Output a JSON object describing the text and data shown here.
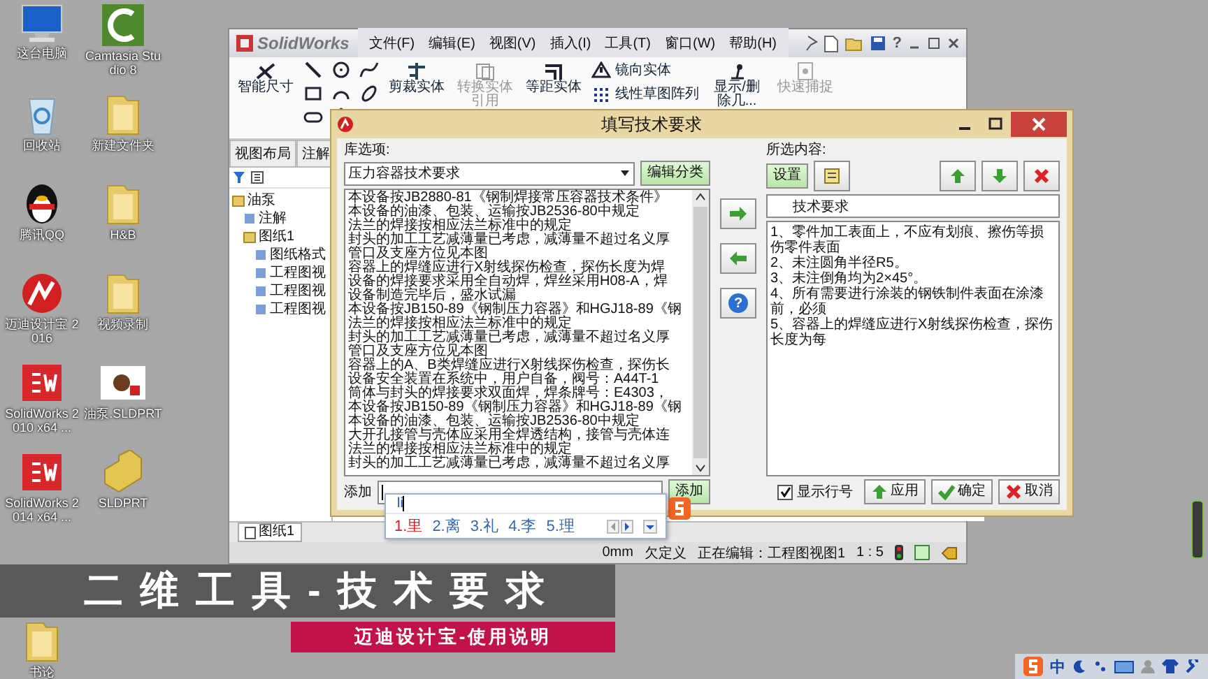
{
  "desktop": {
    "icons": [
      {
        "kind": "computer",
        "label": "这台电脑"
      },
      {
        "kind": "camtasia",
        "label": "Camtasia Studio 8"
      },
      {
        "kind": "recycle",
        "label": "回收站"
      },
      {
        "kind": "folder",
        "label": "新建文件夹"
      },
      {
        "kind": "qq",
        "label": "腾讯QQ"
      },
      {
        "kind": "folder",
        "label": "H&B"
      },
      {
        "kind": "md",
        "label": "迈迪设计宝 2016"
      },
      {
        "kind": "folder",
        "label": "视频录制"
      },
      {
        "kind": "sw",
        "label": "SolidWorks 2010 x64 ..."
      },
      {
        "kind": "thumb",
        "label": "油泵.SLDPRT"
      },
      {
        "kind": "sw",
        "label": "SolidWorks 2014 x64 ..."
      },
      {
        "kind": "part",
        "label": "SLDPRT"
      },
      {
        "kind": "folder",
        "label": "书论"
      }
    ]
  },
  "solidworks": {
    "logo": "SolidWorks",
    "menu": [
      "文件(F)",
      "编辑(E)",
      "视图(V)",
      "插入(I)",
      "工具(T)",
      "窗口(W)",
      "帮助(H)"
    ],
    "help": "?",
    "toolbar": [
      {
        "kind": "large",
        "label": "智能尺寸",
        "disabled": false
      },
      {
        "kind": "sketch-grid"
      },
      {
        "kind": "large",
        "label": "剪裁实体",
        "disabled": false
      },
      {
        "kind": "large",
        "label": "转换实体引用",
        "disabled": true
      },
      {
        "kind": "large",
        "label": "等距实体",
        "disabled": false
      },
      {
        "kind": "stack",
        "items": [
          {
            "label": "镜向实体"
          },
          {
            "label": "线性草图阵列"
          }
        ]
      },
      {
        "kind": "large",
        "label": "显示/删除几...",
        "disabled": false
      },
      {
        "kind": "large",
        "label": "快速捕捉",
        "disabled": true
      }
    ],
    "side_tabs": [
      "视图布局",
      "注解"
    ],
    "tree": [
      {
        "label": "油泵",
        "children": [
          {
            "label": "注解"
          },
          {
            "label": "图纸1",
            "children": [
              {
                "label": "图纸格式"
              },
              {
                "label": "工程图视"
              },
              {
                "label": "工程图视"
              },
              {
                "label": "工程图视"
              }
            ]
          }
        ]
      }
    ],
    "sheet_tab": "图纸1",
    "status": [
      "0mm",
      "欠定义",
      "正在编辑：工程图视图1",
      "1 : 5"
    ]
  },
  "dialog": {
    "title": "填写技术要求",
    "library": {
      "label": "库选项:",
      "category": "压力容器技术要求",
      "edit_button": "编辑分类",
      "lines": [
        "本设备按JB2880-81《钢制焊接常压容器技术条件》",
        "本设备的油漆、包装、运输按JB2536-80中规定",
        "法兰的焊接按相应法兰标准中的规定",
        "封头的加工工艺减薄量已考虑，减薄量不超过名义厚",
        "管口及支座方位见本图",
        "容器上的焊缝应进行X射线探伤检查，探伤长度为焊",
        "设备的焊接要求采用全自动焊，焊丝采用H08-A，焊",
        "设备制造完毕后，盛水试漏",
        "本设备按JB150-89《钢制压力容器》和HGJ18-89《钢",
        "法兰的焊接按相应法兰标准中的规定",
        "封头的加工工艺减薄量已考虑，减薄量不超过名义厚",
        "管口及支座方位见本图",
        "容器上的A、B类焊缝应进行X射线探伤检查，探伤长",
        "设备安全装置在系统中，用户自备，阀号：A44T-1",
        "筒体与封头的焊接要求双面焊，焊条牌号：E4303，",
        "本设备按JB150-89《钢制压力容器》和HGJ18-89《钢",
        "本设备的油漆、包装、运输按JB2536-80中规定",
        "大开孔接管与壳体应采用全焊透结构，接管与壳体连",
        "法兰的焊接按相应法兰标准中的规定",
        "封头的加工工艺减薄量已考虑，减薄量不超过名义厚"
      ],
      "add_label": "添加",
      "add_button": "添加"
    },
    "help_button": "?",
    "selected": {
      "label": "所选内容:",
      "settings_button": "设置",
      "heading": "技术要求",
      "lines": [
        "1、零件加工表面上，不应有划痕、擦伤等损伤零件表面",
        "2、未注圆角半径R5。",
        "3、未注倒角均为2×45°。",
        "4、所有需要进行涂装的钢铁制件表面在涂漆前，必须",
        "5、容器上的焊缝应进行X射线探伤检查，探伤长度为每"
      ],
      "line_numbers": {
        "label": "显示行号",
        "checked": true
      },
      "apply_button": "应用",
      "ok_button": "确定",
      "cancel_button": "取消"
    }
  },
  "ime": {
    "input": "li",
    "candidates": [
      {
        "text": "1.里",
        "selected": true
      },
      {
        "text": "2.离",
        "selected": false
      },
      {
        "text": "3.礼",
        "selected": false
      },
      {
        "text": "4.李",
        "selected": false
      },
      {
        "text": "5.理",
        "selected": false
      }
    ]
  },
  "caption": "二维工具-技术要求",
  "banner": "迈迪设计宝-使用说明",
  "tray": {
    "lang": "中"
  }
}
